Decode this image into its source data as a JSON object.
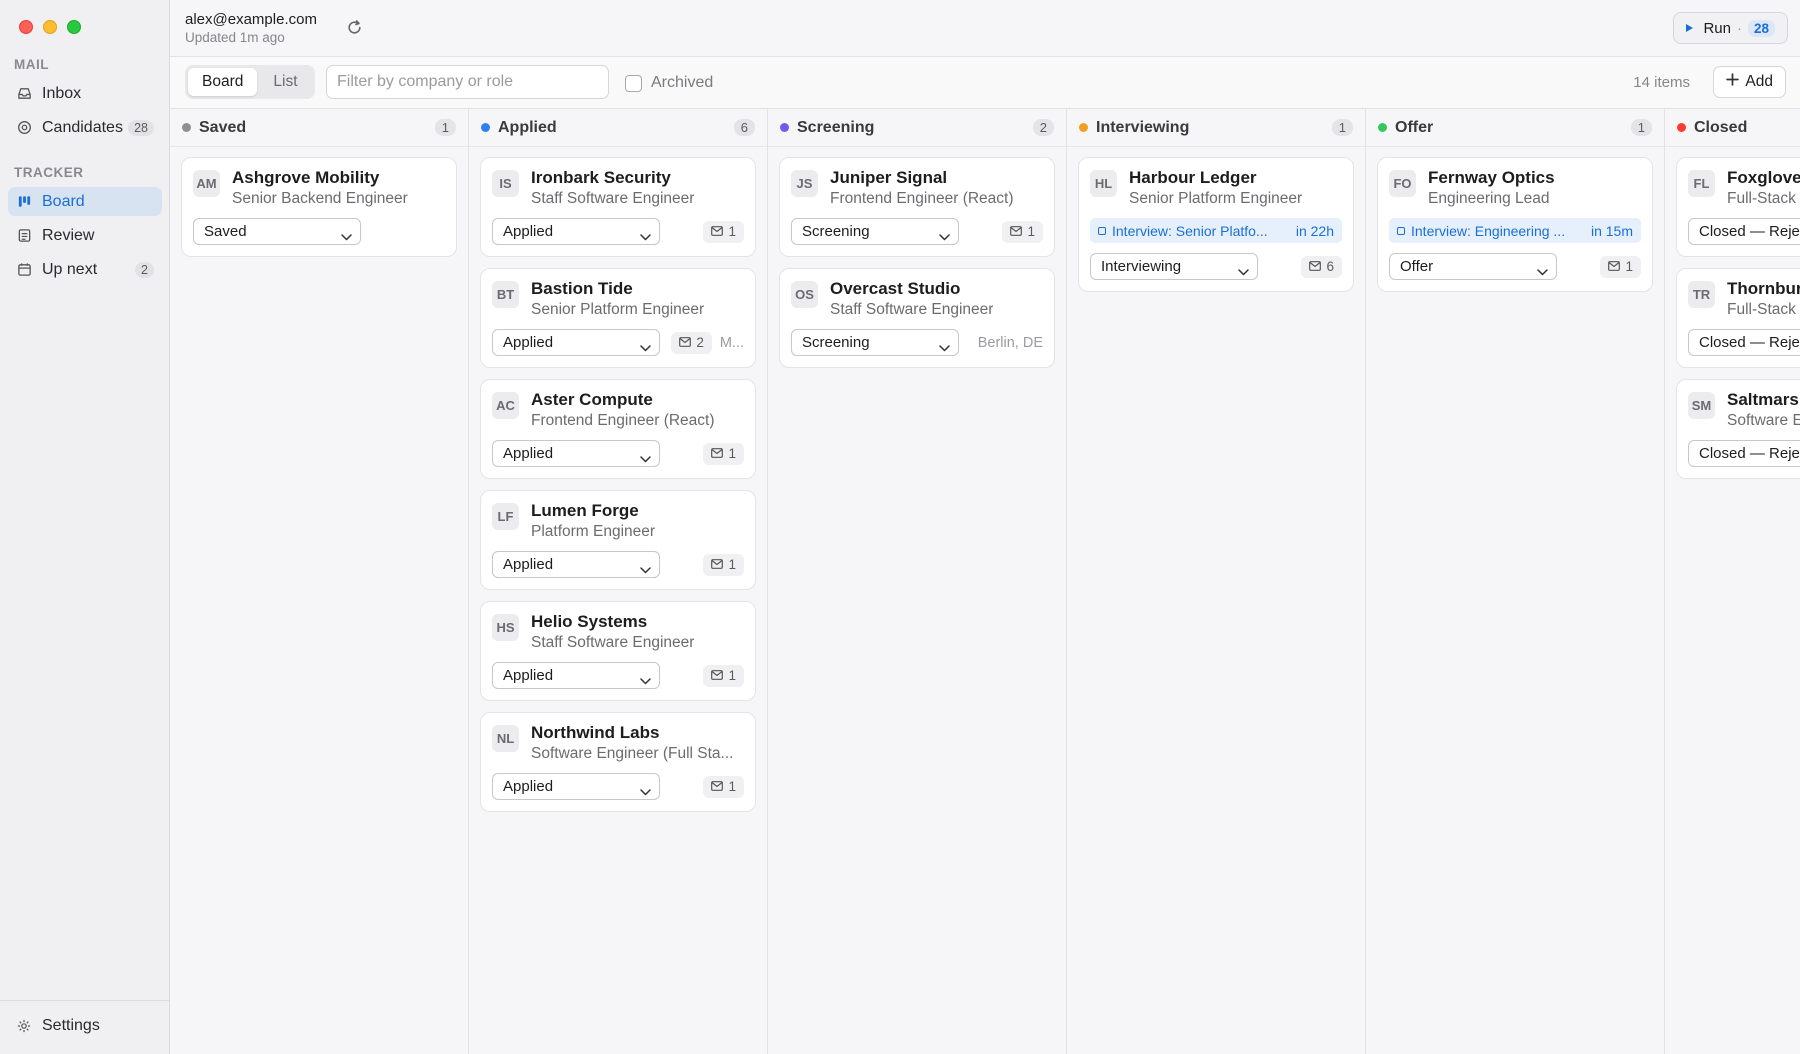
{
  "window": {
    "controls": [
      "close",
      "minimize",
      "zoom"
    ]
  },
  "sidebar": {
    "mail_section": "MAIL",
    "tracker_section": "TRACKER",
    "items": [
      {
        "label": "Inbox",
        "icon": "inbox-icon"
      },
      {
        "label": "Candidates",
        "icon": "target-icon",
        "count": "28"
      },
      {
        "label": "Board",
        "icon": "board-icon",
        "active": true
      },
      {
        "label": "Review",
        "icon": "review-icon"
      },
      {
        "label": "Up next",
        "icon": "calendar-icon",
        "count": "2"
      }
    ],
    "settings_label": "Settings"
  },
  "header": {
    "account_email": "alex@example.com",
    "updated": "Updated 1m ago",
    "run_label": "Run",
    "run_separator": "·",
    "run_count": "28"
  },
  "toolbar": {
    "view_board": "Board",
    "view_list": "List",
    "filter_placeholder": "Filter by company or role",
    "archived_label": "Archived",
    "items_count": "14 items",
    "add_label": "Add"
  },
  "colors": {
    "accent": "#1a6fd6",
    "saved": "#8e8e93",
    "applied": "#2f7ff0",
    "screening": "#6e5cf0",
    "interviewing": "#f0a020",
    "offer": "#34c759",
    "closed": "#ff3b30"
  },
  "columns": [
    {
      "title": "Saved",
      "count": "1",
      "cards": [
        {
          "initials": "AM",
          "company": "Ashgrove Mobility",
          "role": "Senior Backend Engineer",
          "status": "Saved"
        }
      ]
    },
    {
      "title": "Applied",
      "count": "6",
      "cards": [
        {
          "initials": "IS",
          "company": "Ironbark Security",
          "role": "Staff Software Engineer",
          "status": "Applied",
          "mail": "1"
        },
        {
          "initials": "BT",
          "company": "Bastion Tide",
          "role": "Senior Platform Engineer",
          "status": "Applied",
          "mail": "2",
          "extra": "M..."
        },
        {
          "initials": "AC",
          "company": "Aster Compute",
          "role": "Frontend Engineer (React)",
          "status": "Applied",
          "mail": "1"
        },
        {
          "initials": "LF",
          "company": "Lumen Forge",
          "role": "Platform Engineer",
          "status": "Applied",
          "mail": "1"
        },
        {
          "initials": "HS",
          "company": "Helio Systems",
          "role": "Staff Software Engineer",
          "status": "Applied",
          "mail": "1"
        },
        {
          "initials": "NL",
          "company": "Northwind Labs",
          "role": "Software Engineer (Full Sta...",
          "status": "Applied",
          "mail": "1"
        }
      ]
    },
    {
      "title": "Screening",
      "count": "2",
      "cards": [
        {
          "initials": "JS",
          "company": "Juniper Signal",
          "role": "Frontend Engineer (React)",
          "status": "Screening",
          "mail": "1"
        },
        {
          "initials": "OS",
          "company": "Overcast Studio",
          "role": "Staff Software Engineer",
          "status": "Screening",
          "location": "Berlin, DE"
        }
      ]
    },
    {
      "title": "Interviewing",
      "count": "1",
      "cards": [
        {
          "initials": "HL",
          "company": "Harbour Ledger",
          "role": "Senior Platform Engineer",
          "event_title": "Interview: Senior Platfo...",
          "event_when": "in 22h",
          "status": "Interviewing",
          "mail": "6"
        }
      ]
    },
    {
      "title": "Offer",
      "count": "1",
      "cards": [
        {
          "initials": "FO",
          "company": "Fernway Optics",
          "role": "Engineering Lead",
          "event_title": "Interview: Engineering ...",
          "event_when": "in 15m",
          "status": "Offer",
          "mail": "1"
        }
      ]
    },
    {
      "title": "Closed",
      "count": "",
      "cards": [
        {
          "initials": "FL",
          "company": "Foxglove",
          "role": "Full-Stack",
          "status": "Closed — Rejec"
        },
        {
          "initials": "TR",
          "company": "Thornbur",
          "role": "Full-Stack",
          "status": "Closed — Rejec"
        },
        {
          "initials": "SM",
          "company": "Saltmarsh",
          "role": "Software E",
          "status": "Closed — Rejec"
        }
      ]
    }
  ]
}
